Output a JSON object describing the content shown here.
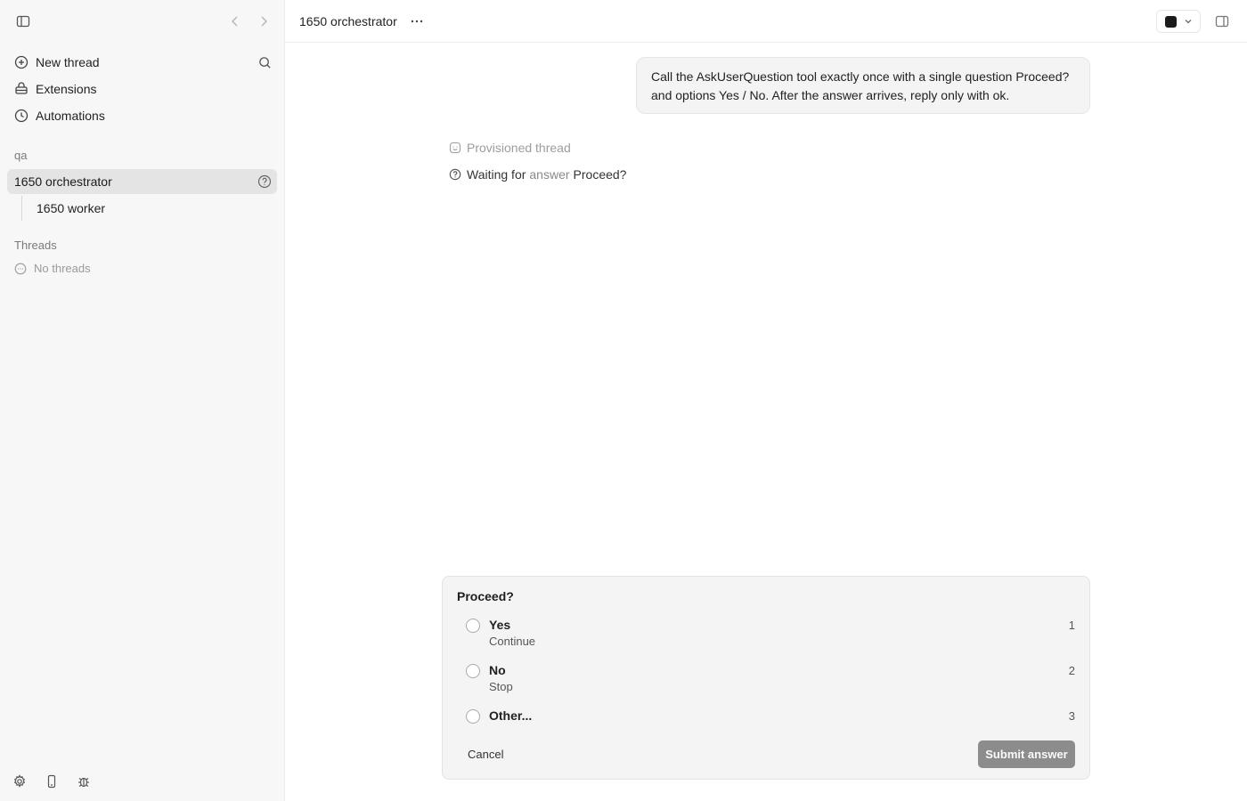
{
  "sidebar": {
    "nav": {
      "new_thread": "New thread",
      "extensions": "Extensions",
      "automations": "Automations"
    },
    "project_label": "qa",
    "active_thread": "1650 orchestrator",
    "child_thread": "1650 worker",
    "threads_label": "Threads",
    "no_threads": "No threads"
  },
  "header": {
    "title": "1650 orchestrator",
    "more_label": "···"
  },
  "conversation": {
    "user_message": "Call the AskUserQuestion tool exactly once with a single question Proceed? and options Yes / No. After the answer arrives, reply only with ok.",
    "status_provisioned": "Provisioned thread",
    "status_waiting_prefix": "Waiting for",
    "status_waiting_muted": "answer",
    "status_waiting_question": "Proceed?"
  },
  "question_card": {
    "title": "Proceed?",
    "options": [
      {
        "label": "Yes",
        "description": "Continue",
        "key": "1"
      },
      {
        "label": "No",
        "description": "Stop",
        "key": "2"
      },
      {
        "label": "Other...",
        "description": "",
        "key": "3"
      }
    ],
    "cancel_label": "Cancel",
    "submit_label": "Submit answer"
  },
  "colors": {
    "sidebar_bg": "#f7f7f7",
    "active_item_bg": "#e4e4e4",
    "card_bg": "#f4f4f4",
    "submit_bg": "#8c8c8c"
  },
  "icons": {
    "sidebar_toggle": "sidebar-toggle-icon",
    "back": "chevron-left-icon",
    "forward": "chevron-right-icon",
    "new_thread": "plus-circle-icon",
    "search": "search-icon",
    "extensions": "extensions-icon",
    "automations": "clock-icon",
    "help": "question-circle-icon",
    "settings": "gear-icon",
    "mobile": "mobile-icon",
    "debug": "bug-icon",
    "panel": "panel-toggle-icon"
  }
}
